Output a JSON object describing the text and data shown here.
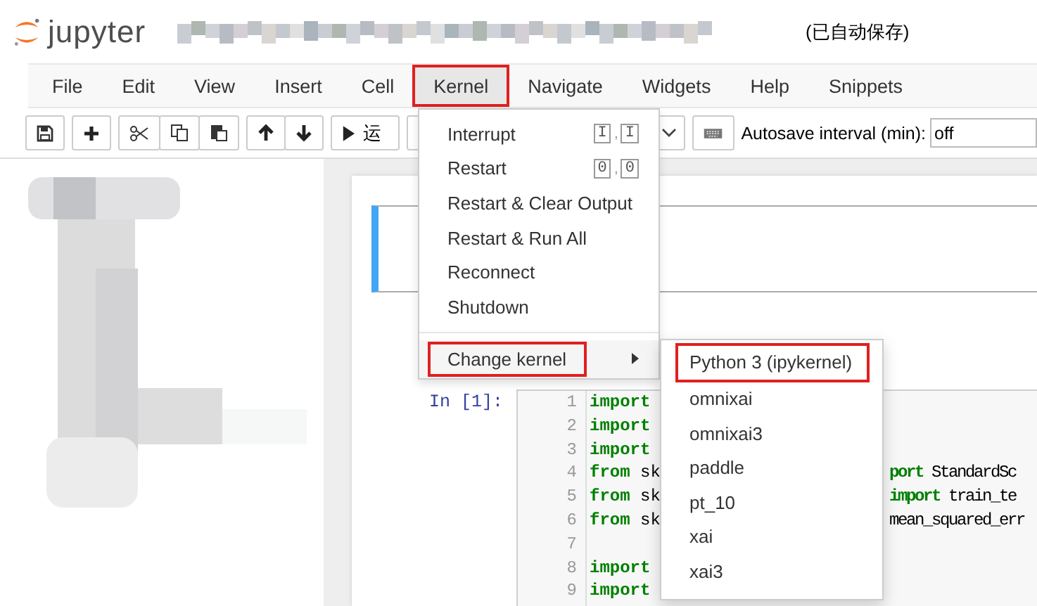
{
  "header": {
    "logo_text": "jupyter",
    "save_status": "(已自动保存)"
  },
  "menubar": [
    {
      "label": "File",
      "selected": false,
      "annotated": false
    },
    {
      "label": "Edit",
      "selected": false,
      "annotated": false
    },
    {
      "label": "View",
      "selected": false,
      "annotated": false
    },
    {
      "label": "Insert",
      "selected": false,
      "annotated": false
    },
    {
      "label": "Cell",
      "selected": false,
      "annotated": false
    },
    {
      "label": "Kernel",
      "selected": true,
      "annotated": true
    },
    {
      "label": "Navigate",
      "selected": false,
      "annotated": false
    },
    {
      "label": "Widgets",
      "selected": false,
      "annotated": false
    },
    {
      "label": "Help",
      "selected": false,
      "annotated": false
    },
    {
      "label": "Snippets",
      "selected": false,
      "annotated": false
    }
  ],
  "toolbar": {
    "groups": [
      [
        {
          "kind": "save"
        }
      ],
      [
        {
          "kind": "add"
        }
      ],
      [
        {
          "kind": "cut"
        },
        {
          "kind": "copy"
        },
        {
          "kind": "paste"
        }
      ],
      [
        {
          "kind": "up"
        },
        {
          "kind": "down"
        }
      ]
    ],
    "run_label": "运",
    "autosave_label": "Autosave interval (min):",
    "autosave_value": "off"
  },
  "kernel_menu": {
    "key_separator": ",",
    "items": [
      {
        "kind": "item",
        "label": "Interrupt",
        "keys": [
          "I",
          "I"
        ]
      },
      {
        "kind": "item",
        "label": "Restart",
        "keys": [
          "0",
          "0"
        ]
      },
      {
        "kind": "item",
        "label": "Restart & Clear Output"
      },
      {
        "kind": "item",
        "label": "Restart & Run All"
      },
      {
        "kind": "item",
        "label": "Reconnect"
      },
      {
        "kind": "item",
        "label": "Shutdown"
      },
      {
        "kind": "divider"
      },
      {
        "kind": "submenu",
        "label": "Change kernel",
        "annotated": true
      }
    ]
  },
  "kernel_submenu": [
    {
      "label": "Python 3 (ipykernel)",
      "annotated": true
    },
    {
      "label": "omnixai",
      "annotated": false
    },
    {
      "label": "omnixai3",
      "annotated": false
    },
    {
      "label": "paddle",
      "annotated": false
    },
    {
      "label": "pt_10",
      "annotated": false
    },
    {
      "label": "xai",
      "annotated": false
    },
    {
      "label": "xai3",
      "annotated": false
    }
  ],
  "cells": [
    {
      "kind": "empty",
      "selected": true
    },
    {
      "kind": "code",
      "prompt": "In [1]:",
      "lines": [
        {
          "number": "1",
          "left": [
            {
              "t": "import",
              "kind": "keyword"
            }
          ]
        },
        {
          "number": "2",
          "left": [
            {
              "t": "import",
              "kind": "keyword"
            }
          ]
        },
        {
          "number": "3",
          "left": [
            {
              "t": "import",
              "kind": "keyword"
            }
          ]
        },
        {
          "number": "4",
          "left": [
            {
              "t": "from",
              "kind": "keyword"
            },
            {
              "t": " sk",
              "kind": "plain"
            }
          ],
          "right": [
            {
              "t": "port",
              "kind": "keyword"
            },
            {
              "t": " StandardSc",
              "kind": "plain"
            }
          ]
        },
        {
          "number": "5",
          "left": [
            {
              "t": "from",
              "kind": "keyword"
            },
            {
              "t": " sk",
              "kind": "plain"
            }
          ],
          "right": [
            {
              "t": "import",
              "kind": "keyword"
            },
            {
              "t": " train_te",
              "kind": "plain"
            }
          ]
        },
        {
          "number": "6",
          "left": [
            {
              "t": "from",
              "kind": "keyword"
            },
            {
              "t": " sk",
              "kind": "plain"
            }
          ],
          "right": [
            {
              "t": "mean_squared_err",
              "kind": "plain"
            }
          ]
        },
        {
          "number": "7"
        },
        {
          "number": "8",
          "left": [
            {
              "t": "import",
              "kind": "keyword"
            }
          ]
        },
        {
          "number": "9",
          "left": [
            {
              "t": "import",
              "kind": "keyword"
            }
          ]
        }
      ]
    }
  ]
}
